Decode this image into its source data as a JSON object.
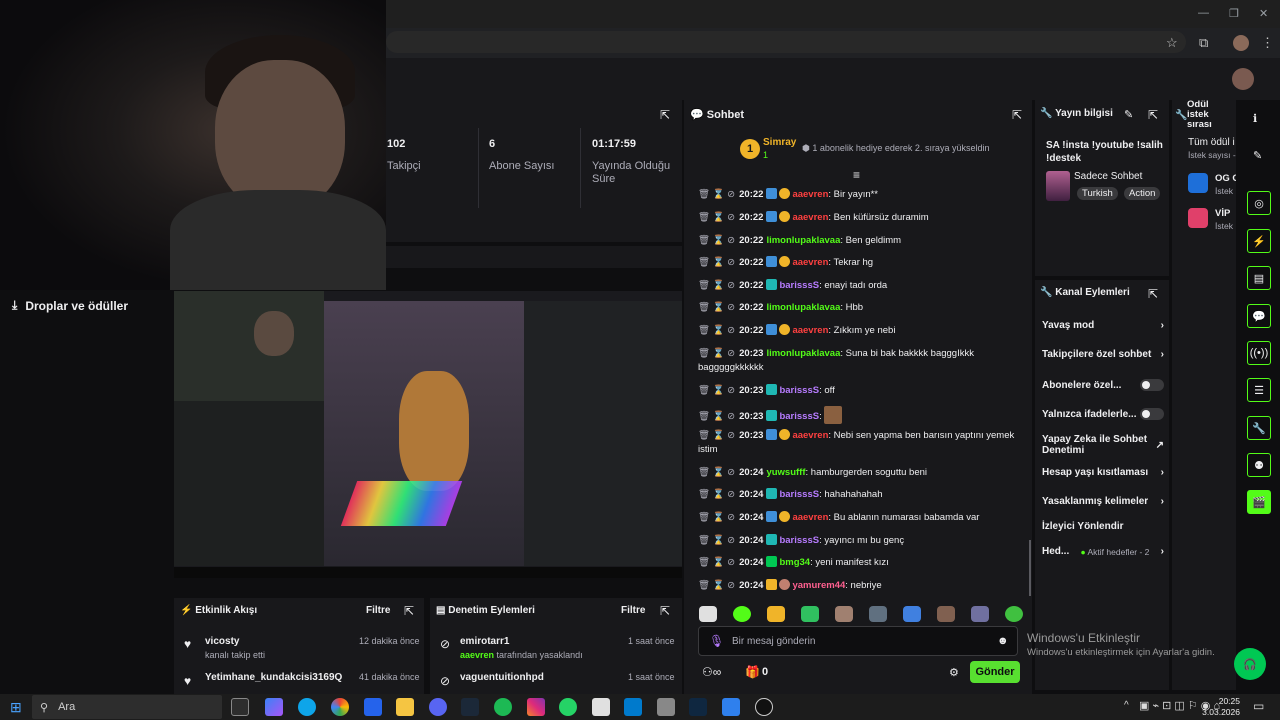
{
  "browser": {
    "minimize": "—",
    "restore": "❐",
    "close": "✕",
    "star": "☆",
    "ext": "⧉",
    "menu": "⋮"
  },
  "stats": [
    {
      "value": "102",
      "label": "Takipçi"
    },
    {
      "value": "6",
      "label": "Abone Sayısı"
    },
    {
      "value": "01:17:59",
      "label": "Yayında Olduğu Süre"
    }
  ],
  "sidebar": {
    "drops_label": "Droplar ve ödüller"
  },
  "chat": {
    "title": "Sohbet",
    "pinned_user": "Simray",
    "pinned_rank": "1",
    "pinned_count": "1",
    "pinned_text": "1 abonelik hediye ederek 2. sıraya yükseldin",
    "messages": [
      {
        "time": "20:22",
        "user": "aaevren",
        "text": "Bir yayın**"
      },
      {
        "time": "20:22",
        "user": "aaevren",
        "text": "Ben küfürsüz duramim"
      },
      {
        "time": "20:22",
        "user": "limonlupaklavaa",
        "text": "Ben geldimm"
      },
      {
        "time": "20:22",
        "user": "aaevren",
        "text": "Tekrar hg"
      },
      {
        "time": "20:22",
        "user": "barisssS",
        "text": "enayi tadı orda"
      },
      {
        "time": "20:22",
        "user": "limonlupaklavaa",
        "text": "Hbb"
      },
      {
        "time": "20:22",
        "user": "aaevren",
        "text": "Zıkkım ye nebi"
      },
      {
        "time": "20:23",
        "user": "limonlupaklavaa",
        "text": "Suna bi bak bakkkk bagggIkkk bagggggkkkkkk"
      },
      {
        "time": "20:23",
        "user": "barisssS",
        "text": "off"
      },
      {
        "time": "20:23",
        "user": "barisssS",
        "text": ""
      },
      {
        "time": "20:23",
        "user": "aaevren",
        "text": "Nebi sen yapma ben barısın yaptını yemek istim"
      },
      {
        "time": "20:24",
        "user": "yuwsufff",
        "text": "hamburgerden soguttu beni"
      },
      {
        "time": "20:24",
        "user": "barisssS",
        "text": "hahahahahah"
      },
      {
        "time": "20:24",
        "user": "aaevren",
        "text": "Bu ablanın numarası babamda var"
      },
      {
        "time": "20:24",
        "user": "barisssS",
        "text": "yayıncı mı bu genç"
      },
      {
        "time": "20:24",
        "user": "bmg34",
        "text": "yeni manifest kızı"
      },
      {
        "time": "20:24",
        "user": "yamurem44",
        "text": "nebriye"
      }
    ],
    "input_placeholder": "Bir mesaj gönderin",
    "points": "0",
    "send_label": "Gönder"
  },
  "info": {
    "title": "Yayın bilgisi",
    "stream_title": "SA !insta !youtube !salih !destek",
    "category": "Sadece Sohbet",
    "tags": [
      "Turkish",
      "Action"
    ]
  },
  "actions": {
    "title": "Kanal Eylemleri",
    "items": [
      {
        "label": "Yavaş mod",
        "kind": "arrow"
      },
      {
        "label": "Takipçilere özel sohbet",
        "kind": "arrow"
      },
      {
        "label": "Abonelere özel...",
        "kind": "toggle"
      },
      {
        "label": "Yalnızca ifadelerle...",
        "kind": "toggle"
      },
      {
        "label": "Yapay Zeka ile Sohbet Denetimi",
        "kind": "external"
      },
      {
        "label": "Hesap yaşı kısıtlaması",
        "kind": "arrow"
      },
      {
        "label": "Yasaklanmış kelimeler",
        "kind": "arrow"
      },
      {
        "label": "İzleyici Yönlendir",
        "kind": "none"
      },
      {
        "label": "Hed...",
        "kind": "arrow",
        "sub": "Aktif hedefler - 2"
      }
    ]
  },
  "queue": {
    "title": "Ödül istek sırası",
    "all": "Tüm ödül i",
    "count": "İstek sayısı -",
    "items": [
      {
        "name": "OG C",
        "sub": "İstek"
      },
      {
        "name": "VİP",
        "sub": "İstek"
      }
    ]
  },
  "events": {
    "title": "Etkinlik Akışı",
    "filter": "Filtre",
    "items": [
      {
        "user": "vicosty",
        "sub": "kanalı takip etti",
        "time": "12 dakika önce"
      },
      {
        "user": "Yetimhane_kundakcisi3169Q",
        "sub": "",
        "time": "41 dakika önce"
      }
    ]
  },
  "moderation": {
    "title": "Denetim Eylemleri",
    "filter": "Filtre",
    "items": [
      {
        "user": "emirotarr1",
        "actor": "aaevren",
        "sub": " tarafından yasaklandı",
        "time": "1 saat önce"
      },
      {
        "user": "vaguentuitionhpd",
        "actor": "",
        "sub": "",
        "time": "1 saat önce"
      }
    ]
  },
  "watermark": {
    "title": "Windows'u Etkinleştir",
    "sub": "Windows'u etkinleştirmek için Ayarlar'a gidin."
  },
  "taskbar": {
    "search": "Ara",
    "time": "20:25",
    "date": "3.03.2026"
  },
  "colors": {
    "accent": "#53fc18",
    "user_red": "#ff4040",
    "user_green": "#53fc18",
    "user_purple": "#b77cff"
  }
}
